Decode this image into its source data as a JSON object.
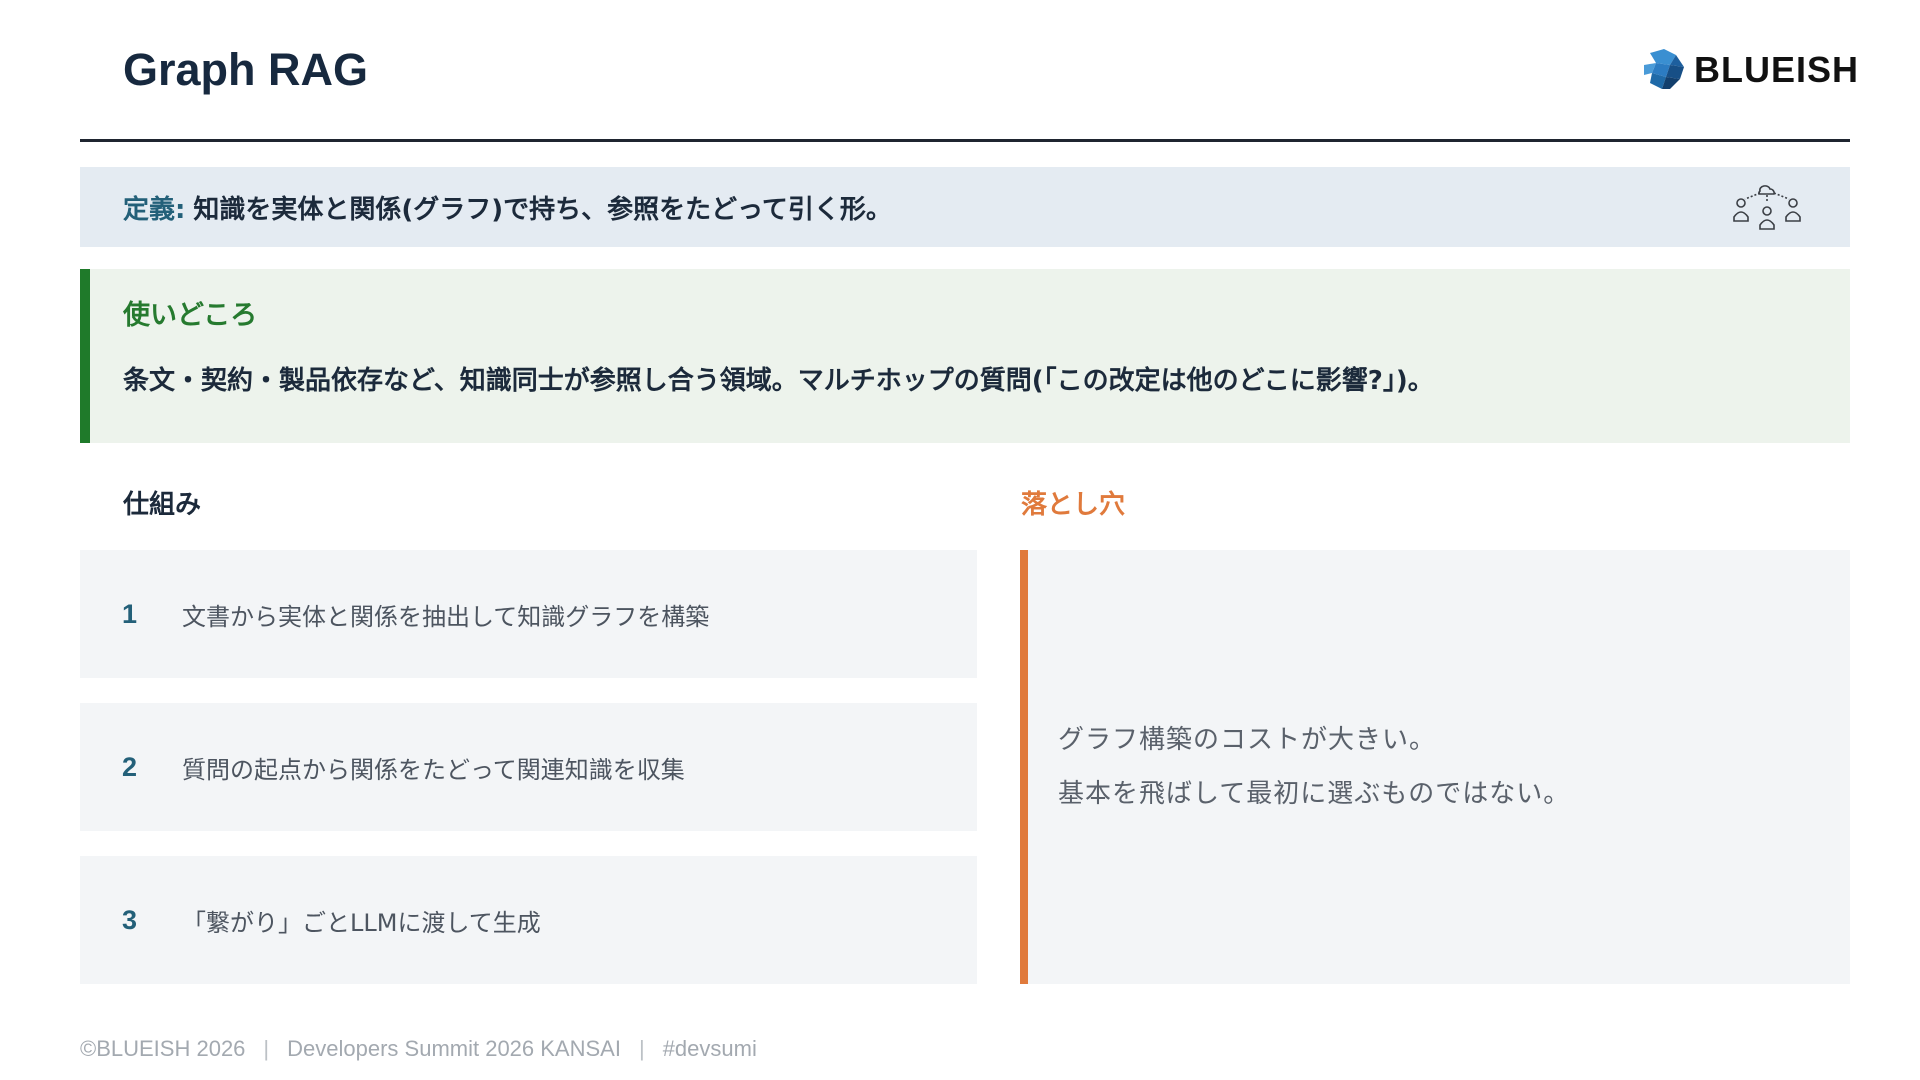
{
  "header": {
    "title": "Graph RAG",
    "logo_text": "BLUEISH"
  },
  "definition": {
    "label": "定義:",
    "text": "知識を実体と関係(グラフ)で持ち、参照をたどって引く形。",
    "icon": "team-network-icon"
  },
  "usecase": {
    "heading": "使いどころ",
    "text": "条文・契約・製品依存など、知識同士が参照し合う領域。マルチホップの質問(「この改定は他のどこに影響?」)。"
  },
  "mechanism": {
    "heading": "仕組み",
    "steps": [
      {
        "num": "1",
        "text": "文書から実体と関係を抽出して知識グラフを構築"
      },
      {
        "num": "2",
        "text": "質問の起点から関係をたどって関連知識を収集"
      },
      {
        "num": "3",
        "text": "「繋がり」ごとLLMに渡して生成"
      }
    ]
  },
  "pitfall": {
    "heading": "落とし穴",
    "lines": [
      "グラフ構築のコストが大きい。",
      "基本を飛ばして最初に選ぶものではない。"
    ]
  },
  "footer": {
    "copyright": "©BLUEISH 2026",
    "event": "Developers Summit 2026 KANSAI",
    "hashtag": "#devsumi"
  },
  "colors": {
    "title": "#17293f",
    "accent_blue": "#236079",
    "accent_green": "#1f7a2a",
    "accent_orange": "#e07a3c"
  }
}
